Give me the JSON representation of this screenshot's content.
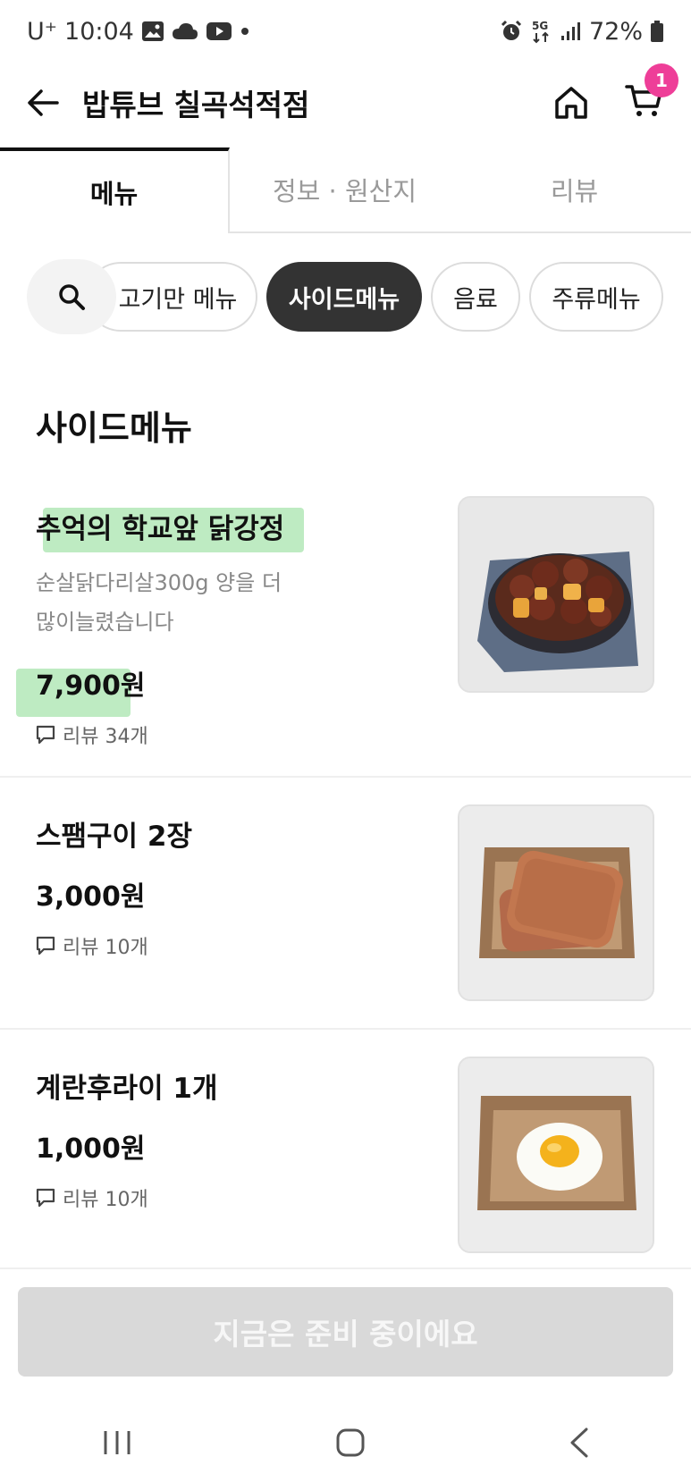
{
  "status_bar": {
    "carrier": "U⁺",
    "time": "10:04",
    "battery": "72%"
  },
  "header": {
    "title": "밥튜브 칠곡석적점",
    "cart_count": "1"
  },
  "tabs": [
    {
      "label": "메뉴",
      "active": true
    },
    {
      "label": "정보 · 원산지",
      "active": false
    },
    {
      "label": "리뷰",
      "active": false
    }
  ],
  "categories": [
    {
      "label": "고기만 메뉴",
      "active": false
    },
    {
      "label": "사이드메뉴",
      "active": true
    },
    {
      "label": "음료",
      "active": false
    },
    {
      "label": "주류메뉴",
      "active": false
    }
  ],
  "section_title": "사이드메뉴",
  "menu_items": [
    {
      "name": "추억의 학교앞 닭강정",
      "description_line1": "순살닭다리살300g  양을 더",
      "description_line2": "많이늘렸습니다",
      "price": "7,900원",
      "reviews": "리뷰 34개"
    },
    {
      "name": "스팸구이 2장",
      "price": "3,000원",
      "reviews": "리뷰 10개"
    },
    {
      "name": "계란후라이 1개",
      "price": "1,000원",
      "reviews": "리뷰 10개"
    }
  ],
  "cta_label": "지금은 준비 중이에요",
  "colors": {
    "badge": "#ee3e98",
    "highlight": "#6ed278",
    "chip_active": "#333333",
    "cta_disabled": "#d9d9d9"
  }
}
